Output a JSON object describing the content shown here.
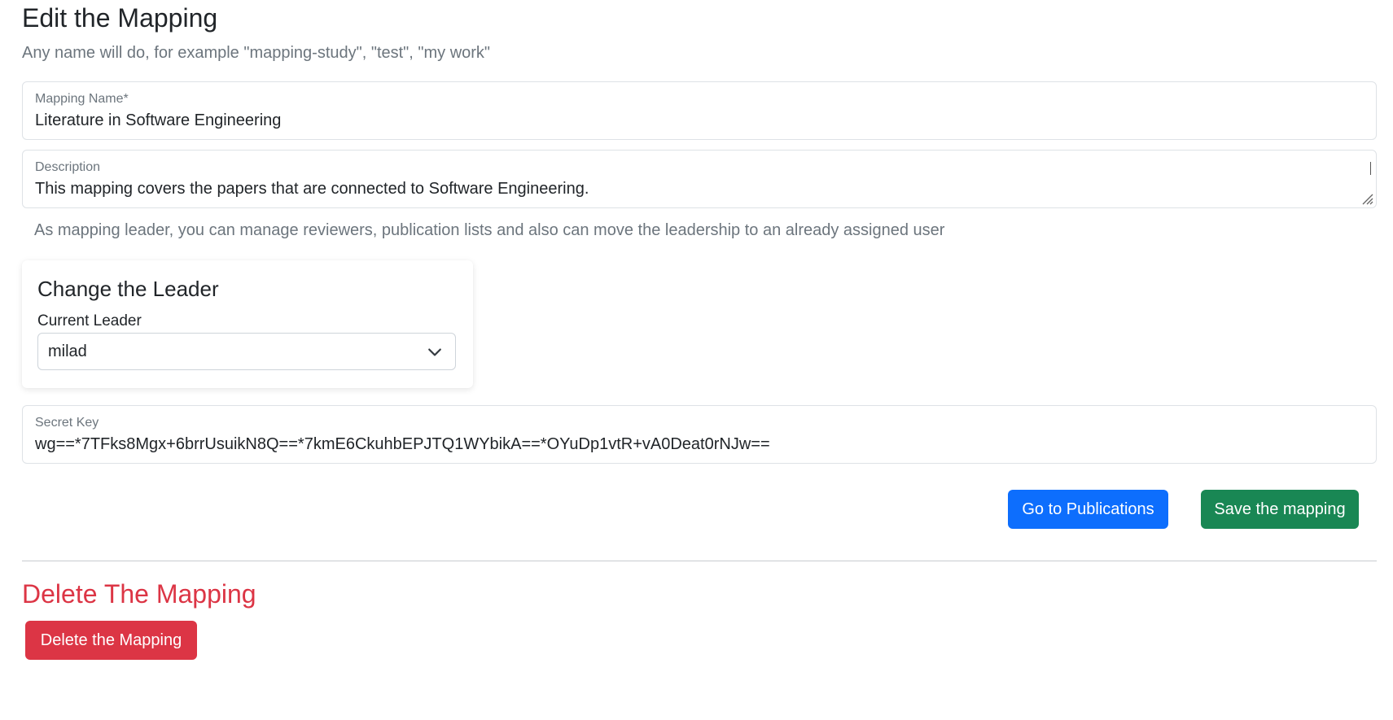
{
  "page": {
    "title": "Edit the Mapping",
    "subtitle": "Any name will do, for example \"mapping-study\", \"test\", \"my work\""
  },
  "fields": {
    "name": {
      "label": "Mapping Name*",
      "value": "Literature in Software Engineering"
    },
    "description": {
      "label": "Description",
      "value": "This mapping covers the papers that are connected to Software Engineering."
    },
    "secret_key": {
      "label": "Secret Key",
      "value": "wg==*7TFks8Mgx+6brrUsuikN8Q==*7kmE6CkuhbEPJTQ1WYbikA==*OYuDp1vtR+vA0Deat0rNJw=="
    }
  },
  "leader_help": "As mapping leader, you can manage reviewers, publication lists and also can move the leadership to an already assigned user",
  "leader_card": {
    "title": "Change the Leader",
    "label": "Current Leader",
    "selected": "milad"
  },
  "actions": {
    "publications_label": "Go to Publications",
    "save_label": "Save the mapping"
  },
  "danger_zone": {
    "title": "Delete The Mapping",
    "delete_label": "Delete the Mapping"
  },
  "colors": {
    "primary": "#0d6efd",
    "success": "#198754",
    "danger": "#dc3545",
    "muted": "#6c757d"
  },
  "icons": {
    "select": "chevron-down-icon",
    "textarea": "resize-handle-icon"
  }
}
